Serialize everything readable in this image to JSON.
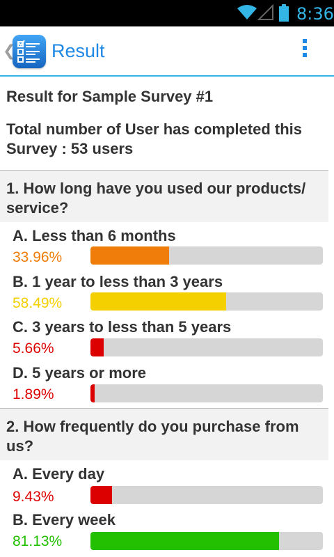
{
  "status_bar": {
    "time": "8:36",
    "icons": [
      "wifi-icon",
      "signal-icon",
      "battery-icon"
    ],
    "color": "#33b5e5"
  },
  "action_bar": {
    "title": "Result",
    "app_icon": "survey-checklist-icon",
    "menu_icon": "overflow-menu-icon",
    "accent": "#1e88e5"
  },
  "survey": {
    "title": "Result for Sample Survey #1",
    "total_text": "Total number of User has completed this Survey : 53 users"
  },
  "questions": [
    {
      "text": "1. How long have you used our products/ service?",
      "options": [
        {
          "label": "A. Less than 6 months",
          "percent_text": "33.96%",
          "value": 33.96,
          "color": "#f07c0a"
        },
        {
          "label": "B. 1 year to less than 3 years",
          "percent_text": "58.49%",
          "value": 58.49,
          "color": "#f5d000"
        },
        {
          "label": "C. 3 years to less than 5 years",
          "percent_text": "5.66%",
          "value": 5.66,
          "color": "#dd0000"
        },
        {
          "label": "D. 5 years or more",
          "percent_text": "1.89%",
          "value": 1.89,
          "color": "#dd0000"
        }
      ]
    },
    {
      "text": "2. How frequently do you purchase from us?",
      "options": [
        {
          "label": "A. Every day",
          "percent_text": "9.43%",
          "value": 9.43,
          "color": "#dd0000"
        },
        {
          "label": "B. Every week",
          "percent_text": "81.13%",
          "value": 81.13,
          "color": "#22c000"
        }
      ]
    }
  ]
}
